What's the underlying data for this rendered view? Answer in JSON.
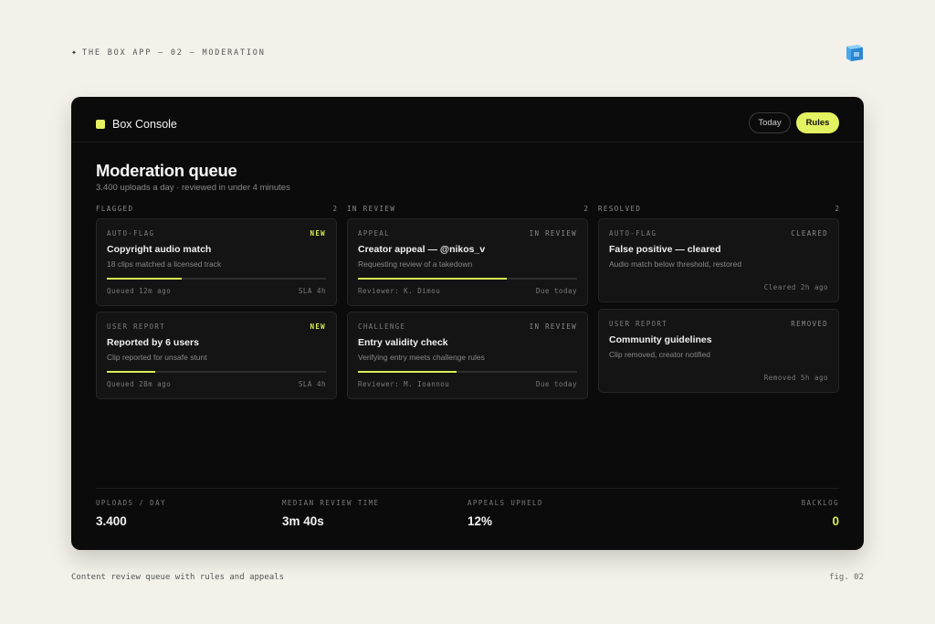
{
  "page": {
    "header": "THE BOX APP — 02 — MODERATION",
    "caption": "Content review queue with rules and appeals",
    "fig": "fig. 02"
  },
  "console": {
    "brand": "Box Console",
    "buttons": {
      "today": "Today",
      "rules": "Rules"
    },
    "title": "Moderation queue",
    "subtitle": "3.400 uploads a day · reviewed in under 4 minutes",
    "accent_color": "#e3f260"
  },
  "columns": [
    {
      "name": "FLAGGED",
      "count": "2",
      "cards": [
        {
          "type": "AUTO-FLAG",
          "badge": "NEW",
          "title": "Copyright audio match",
          "desc": "18 clips matched a licensed track",
          "progress": 0.34,
          "left": "Queued 12m ago",
          "right": "SLA 4h"
        },
        {
          "type": "USER REPORT",
          "badge": "NEW",
          "title": "Reported by 6 users",
          "desc": "Clip reported for unsafe stunt",
          "progress": 0.22,
          "left": "Queued 28m ago",
          "right": "SLA 4h"
        }
      ]
    },
    {
      "name": "IN REVIEW",
      "count": "2",
      "cards": [
        {
          "type": "APPEAL",
          "badge": "IN REVIEW",
          "title": "Creator appeal — @nikos_v",
          "desc": "Requesting review of a takedown",
          "progress": 0.68,
          "left": "Reviewer: K. Dimou",
          "right": "Due today"
        },
        {
          "type": "CHALLENGE",
          "badge": "IN REVIEW",
          "title": "Entry validity check",
          "desc": "Verifying entry meets challenge rules",
          "progress": 0.45,
          "left": "Reviewer: M. Ioannou",
          "right": "Due today"
        }
      ]
    },
    {
      "name": "RESOLVED",
      "count": "2",
      "cards": [
        {
          "type": "AUTO-FLAG",
          "badge": "CLEARED",
          "title": "False positive — cleared",
          "desc": "Audio match below threshold, restored",
          "right": "Cleared 2h ago"
        },
        {
          "type": "USER REPORT",
          "badge": "REMOVED",
          "title": "Community guidelines",
          "desc": "Clip removed, creator notified",
          "right": "Removed 5h ago"
        }
      ]
    }
  ],
  "stats": [
    {
      "label": "UPLOADS / DAY",
      "value": "3.400"
    },
    {
      "label": "MEDIAN REVIEW TIME",
      "value": "3m 40s"
    },
    {
      "label": "APPEALS UPHELD",
      "value": "12%"
    },
    {
      "label": "BACKLOG",
      "value": "0"
    }
  ]
}
